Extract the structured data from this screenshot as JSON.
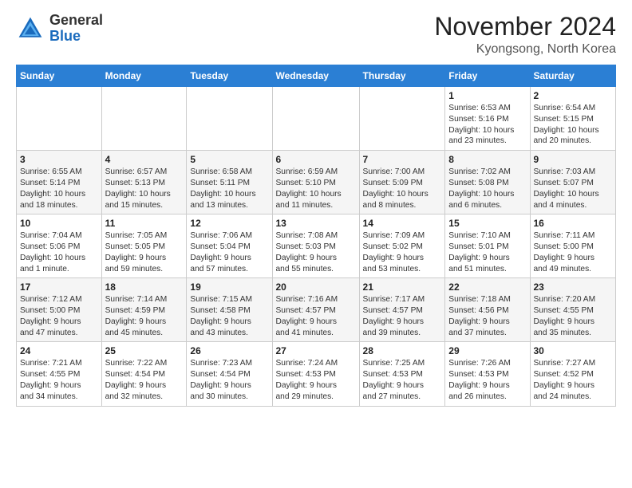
{
  "header": {
    "logo_line1": "General",
    "logo_line2": "Blue",
    "month": "November 2024",
    "location": "Kyongsong, North Korea"
  },
  "weekdays": [
    "Sunday",
    "Monday",
    "Tuesday",
    "Wednesday",
    "Thursday",
    "Friday",
    "Saturday"
  ],
  "weeks": [
    [
      {
        "day": "",
        "info": ""
      },
      {
        "day": "",
        "info": ""
      },
      {
        "day": "",
        "info": ""
      },
      {
        "day": "",
        "info": ""
      },
      {
        "day": "",
        "info": ""
      },
      {
        "day": "1",
        "info": "Sunrise: 6:53 AM\nSunset: 5:16 PM\nDaylight: 10 hours\nand 23 minutes."
      },
      {
        "day": "2",
        "info": "Sunrise: 6:54 AM\nSunset: 5:15 PM\nDaylight: 10 hours\nand 20 minutes."
      }
    ],
    [
      {
        "day": "3",
        "info": "Sunrise: 6:55 AM\nSunset: 5:14 PM\nDaylight: 10 hours\nand 18 minutes."
      },
      {
        "day": "4",
        "info": "Sunrise: 6:57 AM\nSunset: 5:13 PM\nDaylight: 10 hours\nand 15 minutes."
      },
      {
        "day": "5",
        "info": "Sunrise: 6:58 AM\nSunset: 5:11 PM\nDaylight: 10 hours\nand 13 minutes."
      },
      {
        "day": "6",
        "info": "Sunrise: 6:59 AM\nSunset: 5:10 PM\nDaylight: 10 hours\nand 11 minutes."
      },
      {
        "day": "7",
        "info": "Sunrise: 7:00 AM\nSunset: 5:09 PM\nDaylight: 10 hours\nand 8 minutes."
      },
      {
        "day": "8",
        "info": "Sunrise: 7:02 AM\nSunset: 5:08 PM\nDaylight: 10 hours\nand 6 minutes."
      },
      {
        "day": "9",
        "info": "Sunrise: 7:03 AM\nSunset: 5:07 PM\nDaylight: 10 hours\nand 4 minutes."
      }
    ],
    [
      {
        "day": "10",
        "info": "Sunrise: 7:04 AM\nSunset: 5:06 PM\nDaylight: 10 hours\nand 1 minute."
      },
      {
        "day": "11",
        "info": "Sunrise: 7:05 AM\nSunset: 5:05 PM\nDaylight: 9 hours\nand 59 minutes."
      },
      {
        "day": "12",
        "info": "Sunrise: 7:06 AM\nSunset: 5:04 PM\nDaylight: 9 hours\nand 57 minutes."
      },
      {
        "day": "13",
        "info": "Sunrise: 7:08 AM\nSunset: 5:03 PM\nDaylight: 9 hours\nand 55 minutes."
      },
      {
        "day": "14",
        "info": "Sunrise: 7:09 AM\nSunset: 5:02 PM\nDaylight: 9 hours\nand 53 minutes."
      },
      {
        "day": "15",
        "info": "Sunrise: 7:10 AM\nSunset: 5:01 PM\nDaylight: 9 hours\nand 51 minutes."
      },
      {
        "day": "16",
        "info": "Sunrise: 7:11 AM\nSunset: 5:00 PM\nDaylight: 9 hours\nand 49 minutes."
      }
    ],
    [
      {
        "day": "17",
        "info": "Sunrise: 7:12 AM\nSunset: 5:00 PM\nDaylight: 9 hours\nand 47 minutes."
      },
      {
        "day": "18",
        "info": "Sunrise: 7:14 AM\nSunset: 4:59 PM\nDaylight: 9 hours\nand 45 minutes."
      },
      {
        "day": "19",
        "info": "Sunrise: 7:15 AM\nSunset: 4:58 PM\nDaylight: 9 hours\nand 43 minutes."
      },
      {
        "day": "20",
        "info": "Sunrise: 7:16 AM\nSunset: 4:57 PM\nDaylight: 9 hours\nand 41 minutes."
      },
      {
        "day": "21",
        "info": "Sunrise: 7:17 AM\nSunset: 4:57 PM\nDaylight: 9 hours\nand 39 minutes."
      },
      {
        "day": "22",
        "info": "Sunrise: 7:18 AM\nSunset: 4:56 PM\nDaylight: 9 hours\nand 37 minutes."
      },
      {
        "day": "23",
        "info": "Sunrise: 7:20 AM\nSunset: 4:55 PM\nDaylight: 9 hours\nand 35 minutes."
      }
    ],
    [
      {
        "day": "24",
        "info": "Sunrise: 7:21 AM\nSunset: 4:55 PM\nDaylight: 9 hours\nand 34 minutes."
      },
      {
        "day": "25",
        "info": "Sunrise: 7:22 AM\nSunset: 4:54 PM\nDaylight: 9 hours\nand 32 minutes."
      },
      {
        "day": "26",
        "info": "Sunrise: 7:23 AM\nSunset: 4:54 PM\nDaylight: 9 hours\nand 30 minutes."
      },
      {
        "day": "27",
        "info": "Sunrise: 7:24 AM\nSunset: 4:53 PM\nDaylight: 9 hours\nand 29 minutes."
      },
      {
        "day": "28",
        "info": "Sunrise: 7:25 AM\nSunset: 4:53 PM\nDaylight: 9 hours\nand 27 minutes."
      },
      {
        "day": "29",
        "info": "Sunrise: 7:26 AM\nSunset: 4:53 PM\nDaylight: 9 hours\nand 26 minutes."
      },
      {
        "day": "30",
        "info": "Sunrise: 7:27 AM\nSunset: 4:52 PM\nDaylight: 9 hours\nand 24 minutes."
      }
    ]
  ]
}
